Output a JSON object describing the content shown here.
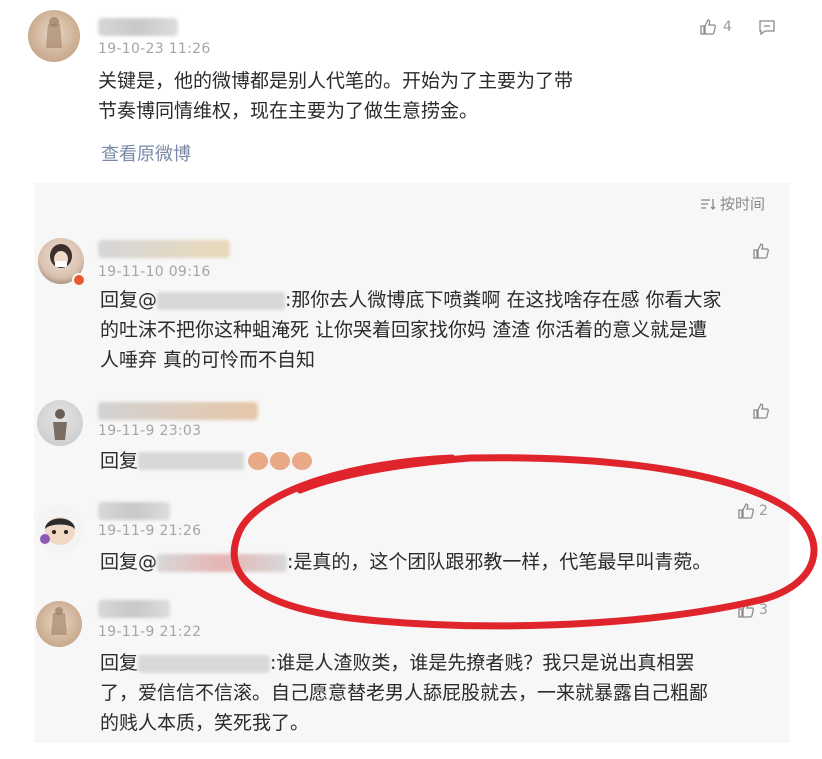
{
  "main_post": {
    "timestamp": "19-10-23 11:26",
    "like_count": "4",
    "text_line1": "关键是，他的微博都是别人代笔的。开始为了主要为了带",
    "text_line2": "节奏博同情维权，现在主要为了做生意捞金。",
    "view_original": "查看原微博"
  },
  "sort": {
    "label": "按时间"
  },
  "comments": [
    {
      "timestamp": "19-11-10 09:16",
      "line1_prefix": "回复@",
      "line1_rest": ":那你去人微博底下喷粪啊 在这找啥存在感 你看大家",
      "line2": "的吐沫不把你这种蛆淹死 让你哭着回家找你妈 渣渣 你活着的意义就是遭",
      "line3": "人唾弃 真的可怜而不自知"
    },
    {
      "timestamp": "19-11-9 23:03",
      "line1_prefix": "回复"
    },
    {
      "timestamp": "19-11-9 21:26",
      "like_count": "2",
      "line1_prefix": "回复@",
      "line1_rest": ":是真的，这个团队跟邪教一样，代笔最早叫青菀。"
    },
    {
      "timestamp": "19-11-9 21:22",
      "like_count": "3",
      "line1_prefix": "回复",
      "line1_rest": ":谁是人渣败类，谁是先撩者贱？我只是说出真相罢",
      "line2": "了，爱信信不信滚。自己愿意替老男人舔屁股就去，一来就暴露自己粗鄙",
      "line3": "的贱人本质，笑死我了。"
    }
  ],
  "colors": {
    "highlight_circle": "#e0242c",
    "link": "#7a8aa6",
    "panel_bg": "#f7f7f7"
  }
}
